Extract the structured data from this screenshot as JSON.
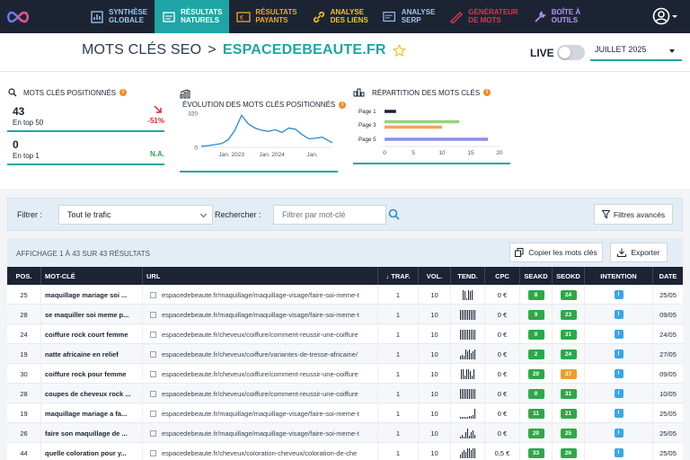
{
  "nav": {
    "items": [
      {
        "label": "Synthèse\nglobale",
        "icon": "dashboard-icon",
        "active": false
      },
      {
        "label": "Résultats\nnaturels",
        "icon": "seo-results-icon",
        "active": true
      },
      {
        "label": "Résultats\npayants",
        "icon": "paid-results-icon",
        "active": false
      },
      {
        "label": "Analyse\ndes liens",
        "icon": "links-icon",
        "active": false
      },
      {
        "label": "Analyse\nSERP",
        "icon": "serp-icon",
        "active": false
      },
      {
        "label": "Générateur\nde mots",
        "icon": "generator-icon",
        "active": false
      },
      {
        "label": "Boîte à\noutils",
        "icon": "tools-icon",
        "active": false
      }
    ],
    "colors": {
      "background": "#1c2434",
      "active": "#1fa5a5",
      "nav_text": [
        "#9cc6ee",
        "#ffffff",
        "#f5a623",
        "#f5c518",
        "#9cc6ee",
        "#e0334f",
        "#b794f6"
      ]
    }
  },
  "header": {
    "title": "MOTS CLÉS SEO",
    "separator": ">",
    "domain": "ESPACEDEBEAUTE.FR",
    "live_label": "LIVE",
    "live_on": false,
    "month": "JUILLET 2025"
  },
  "stats": {
    "positioned": {
      "title": "MOTS CLÉS POSITIONNÉS",
      "top50_value": "43",
      "top50_label": "En top 50",
      "top50_delta": "-51%",
      "top1_value": "0",
      "top1_label": "En top 1",
      "top1_delta": "N.A."
    },
    "evolution": {
      "title": "ÉVOLUTION DES MOTS CLÉS POSITIONNÉS"
    },
    "distribution": {
      "title": "RÉPARTITION DES MOTS CLÉS"
    }
  },
  "chart_data": [
    {
      "type": "line",
      "title": "ÉVOLUTION DES MOTS CLÉS POSITIONNÉS",
      "xlabel": "",
      "ylabel": "",
      "ylim": [
        0,
        320
      ],
      "yticks": [
        "320",
        "0"
      ],
      "x_tick_labels": [
        "Jan. 2023",
        "Jan. 2024",
        "Jan."
      ],
      "x_range": [
        "2022-04",
        "2025-07"
      ],
      "x": [
        "2022-04",
        "2022-06",
        "2022-08",
        "2022-10",
        "2022-12",
        "2023-02",
        "2023-04",
        "2023-06",
        "2023-08",
        "2023-10",
        "2023-12",
        "2024-02",
        "2024-04",
        "2024-06",
        "2024-08",
        "2024-10",
        "2024-12",
        "2025-02",
        "2025-04",
        "2025-06",
        "2025-07"
      ],
      "values": [
        10,
        15,
        25,
        35,
        70,
        160,
        300,
        220,
        180,
        160,
        150,
        165,
        140,
        180,
        170,
        120,
        80,
        85,
        95,
        60,
        43
      ],
      "color": "#2b8ad1",
      "grid": false
    },
    {
      "type": "bar",
      "orientation": "horizontal",
      "title": "RÉPARTITION DES MOTS CLÉS",
      "categories": [
        "Page 1",
        "Page 3",
        "Page 5"
      ],
      "ylim": [
        0,
        20
      ],
      "xticks": [
        "0",
        "5",
        "10",
        "15",
        "20"
      ],
      "series": [
        {
          "values": [
            2,
            0,
            0
          ],
          "color": "#1c2434"
        },
        {
          "values": [
            0,
            13,
            0
          ],
          "color": "#8fd67a"
        },
        {
          "values": [
            0,
            10,
            0
          ],
          "color": "#f5a35c"
        },
        {
          "values": [
            0,
            0,
            18
          ],
          "color": "#8a8fe6"
        }
      ]
    }
  ],
  "filters": {
    "filter_label": "Filtrer :",
    "filter_value": "Tout le trafic",
    "search_label": "Rechercher :",
    "search_placeholder": "Filtrer par mot-clé",
    "advanced": "Filtres avancés"
  },
  "results": {
    "count_text": "AFFICHAGE 1 À 43 SUR 43 RÉSULTATS",
    "copy_label": "Copier les mots clés",
    "export_label": "Exporter"
  },
  "table": {
    "columns": {
      "pos": "POS.",
      "kw": "MOT-CLÉ",
      "url": "URL",
      "traf": "↓ TRAF.",
      "vol": "VOL.",
      "tend": "TEND.",
      "cpc": "CPC",
      "seakd": "SEAKD",
      "seokd": "SEOKD",
      "intent": "INTENTION",
      "date": "DATE"
    },
    "rows": [
      {
        "pos": "25",
        "kw": "maquillage mariage soi ...",
        "url": "espacedebeaute.fr/maquillage/maquillage-visage/faire-soi-meme-t",
        "traf": "1",
        "vol": "10",
        "cpc": "0 €",
        "seakd": "8",
        "seakd_color": "#2ea84a",
        "seokd": "24",
        "seokd_color": "#2ea84a",
        "intent": "I",
        "date": "25/05",
        "tend": [
          10,
          9,
          2,
          10,
          9,
          10
        ]
      },
      {
        "pos": "28",
        "kw": "se maquiller soi meme p...",
        "url": "espacedebeaute.fr/maquillage/maquillage-visage/faire-soi-meme-t",
        "traf": "1",
        "vol": "10",
        "cpc": "0 €",
        "seakd": "9",
        "seakd_color": "#2ea84a",
        "seokd": "23",
        "seokd_color": "#2ea84a",
        "intent": "I",
        "date": "09/05",
        "tend": [
          10,
          10,
          10,
          10,
          10,
          10,
          10,
          10,
          10
        ]
      },
      {
        "pos": "24",
        "kw": "coiffure rock court femme",
        "url": "espacedebeaute.fr/cheveux/coiffure/comment-reussir-une-coiffure",
        "traf": "1",
        "vol": "10",
        "cpc": "0 €",
        "seakd": "0",
        "seakd_color": "#2ea84a",
        "seokd": "31",
        "seokd_color": "#2ea84a",
        "intent": "I",
        "date": "24/05",
        "tend": [
          10,
          10,
          10,
          10,
          10,
          10,
          10,
          10,
          10
        ]
      },
      {
        "pos": "19",
        "kw": "natte africaine en relief",
        "url": "espacedebeaute.fr/cheveux/coiffure/variantes-de-tresse-africaine/",
        "traf": "1",
        "vol": "10",
        "cpc": "0 €",
        "seakd": "2",
        "seakd_color": "#2ea84a",
        "seokd": "24",
        "seokd_color": "#2ea84a",
        "intent": "I",
        "date": "27/05",
        "tend": [
          4,
          5,
          4,
          10,
          8,
          10,
          6,
          8,
          10
        ]
      },
      {
        "pos": "30",
        "kw": "coiffure rock pour femme",
        "url": "espacedebeaute.fr/cheveux/coiffure/comment-reussir-une-coiffure",
        "traf": "1",
        "vol": "10",
        "cpc": "0 €",
        "seakd": "20",
        "seakd_color": "#2ea84a",
        "seokd": "37",
        "seokd_color": "#e8a02a",
        "intent": "I",
        "date": "09/05",
        "tend": [
          10,
          10,
          4,
          10,
          10,
          8,
          4,
          10
        ]
      },
      {
        "pos": "28",
        "kw": "coupes de cheveux rock ...",
        "url": "espacedebeaute.fr/cheveux/coiffure/comment-reussir-une-coiffure",
        "traf": "1",
        "vol": "10",
        "cpc": "0 €",
        "seakd": "0",
        "seakd_color": "#2ea84a",
        "seokd": "31",
        "seokd_color": "#2ea84a",
        "intent": "I",
        "date": "10/05",
        "tend": [
          10,
          10,
          10,
          10,
          10,
          10,
          10,
          10,
          10
        ]
      },
      {
        "pos": "19",
        "kw": "maquillage mariage a fa...",
        "url": "espacedebeaute.fr/maquillage/maquillage-visage/faire-soi-meme-t",
        "traf": "1",
        "vol": "10",
        "cpc": "0 €",
        "seakd": "11",
        "seakd_color": "#2ea84a",
        "seokd": "21",
        "seokd_color": "#2ea84a",
        "intent": "I",
        "date": "25/05",
        "tend": [
          2,
          2,
          2,
          2,
          2,
          3,
          3,
          4,
          10
        ]
      },
      {
        "pos": "26",
        "kw": "faire son maquillage de ...",
        "url": "espacedebeaute.fr/maquillage/maquillage-visage/faire-soi-meme-t",
        "traf": "1",
        "vol": "10",
        "cpc": "0 €",
        "seakd": "20",
        "seakd_color": "#2ea84a",
        "seokd": "25",
        "seokd_color": "#2ea84a",
        "intent": "I",
        "date": "25/05",
        "tend": [
          2,
          4,
          2,
          6,
          10,
          3,
          6,
          8,
          4
        ]
      },
      {
        "pos": "44",
        "kw": "quelle coloration pour y...",
        "url": "espacedebeaute.fr/cheveux/coloration-cheveux/coloration-de-che",
        "traf": "1",
        "vol": "10",
        "cpc": "0,5 €",
        "seakd": "33",
        "seakd_color": "#2ea84a",
        "seokd": "26",
        "seokd_color": "#2ea84a",
        "intent": "I",
        "date": "25/05",
        "tend": [
          4,
          6,
          8,
          6,
          10,
          10,
          8,
          10,
          10
        ]
      }
    ]
  }
}
